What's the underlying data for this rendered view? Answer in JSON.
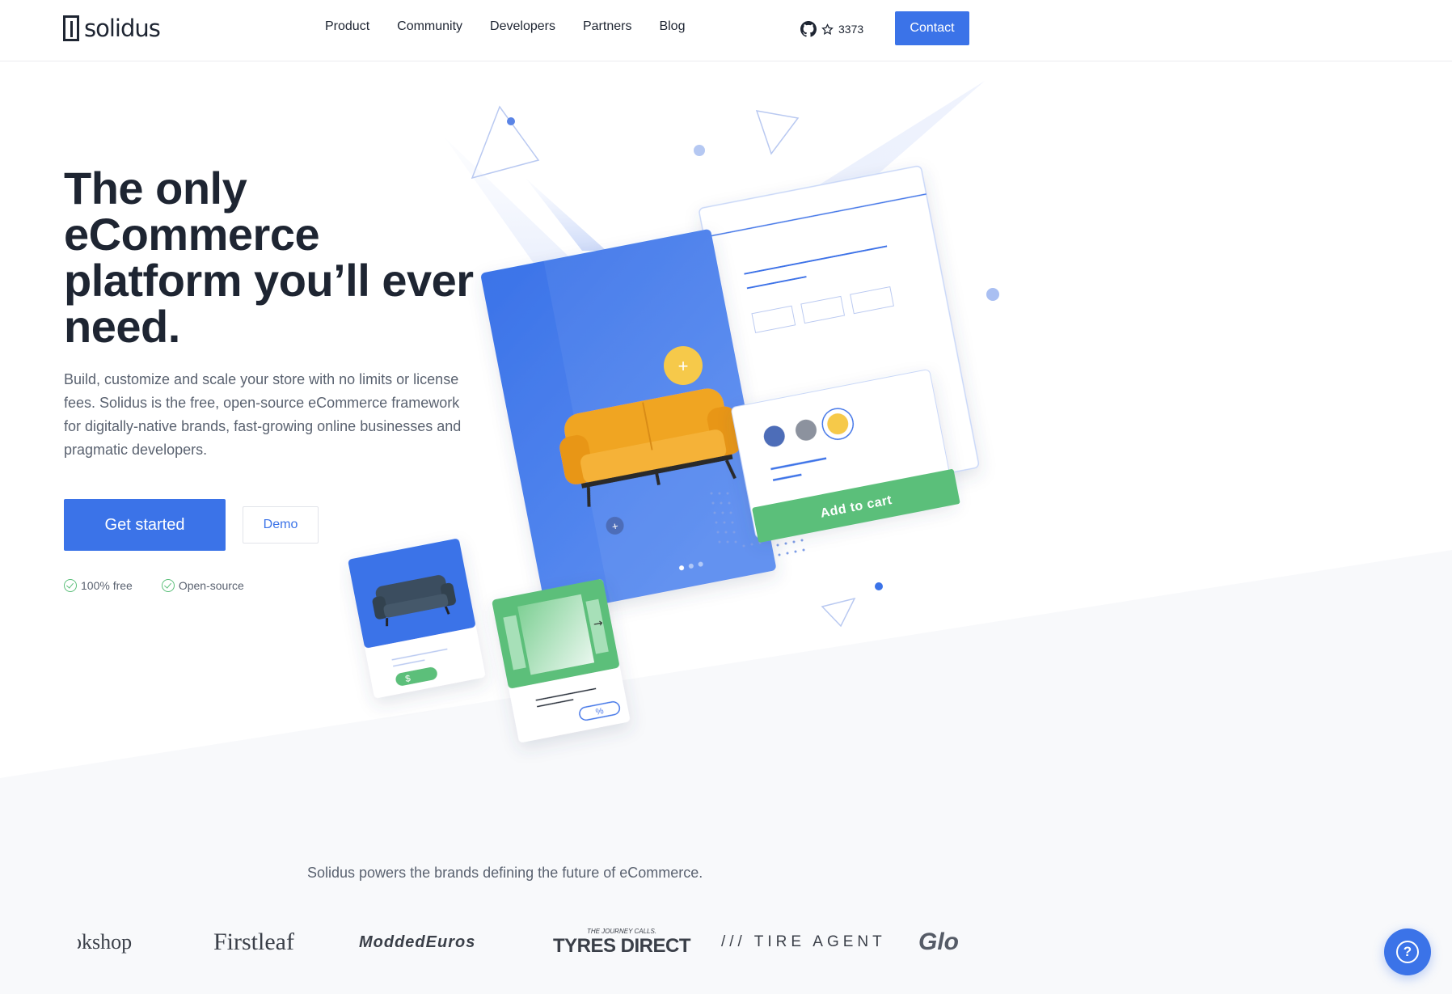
{
  "brand": {
    "name": "solidus"
  },
  "nav": {
    "items": [
      {
        "label": "Product"
      },
      {
        "label": "Community"
      },
      {
        "label": "Developers"
      },
      {
        "label": "Partners"
      },
      {
        "label": "Blog"
      }
    ],
    "github_stars": "3373",
    "contact_label": "Contact"
  },
  "hero": {
    "title": "The only eCommerce platform you’ll ever need.",
    "subtitle": "Build, customize and scale your store with no limits or license fees. Solidus is the free, open-source eCommerce framework for digitally-native brands, fast-growing online businesses and pragmatic developers.",
    "primary_cta": "Get started",
    "secondary_cta": "Demo",
    "checks": [
      {
        "label": "100% free"
      },
      {
        "label": "Open-source"
      }
    ],
    "illustration": {
      "add_to_cart_label": "Add to cart",
      "plus_glyph": "+",
      "dollar_glyph": "$",
      "percent_glyph": "%",
      "accent_blue": "#3b73e8",
      "accent_yellow": "#f6c94a",
      "accent_green": "#5bbf7a"
    }
  },
  "brands": {
    "caption": "Solidus powers the brands defining the future of eCommerce.",
    "logos": [
      {
        "label": "okshop"
      },
      {
        "label": "Firstleaf"
      },
      {
        "label": "ModdedEuros"
      },
      {
        "label": "THE JOURNEY CALLS.",
        "sub": "TYRES DIRECT"
      },
      {
        "label": "/// TIRE AGENT"
      },
      {
        "label": "Glo"
      }
    ]
  },
  "help": {
    "glyph": "?"
  }
}
